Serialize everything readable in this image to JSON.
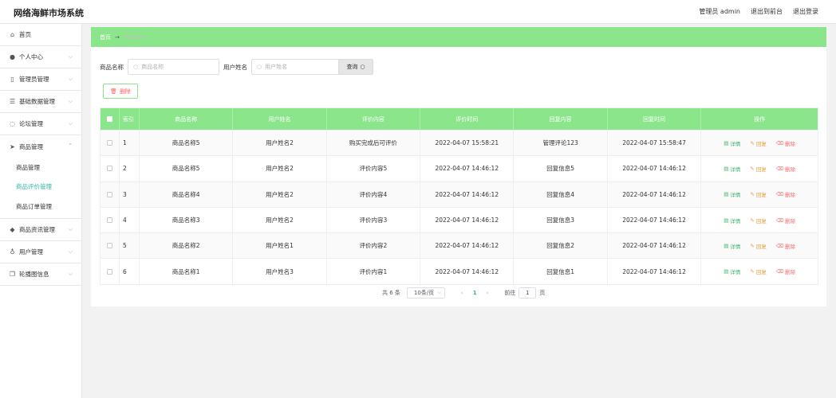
{
  "header": {
    "title": "网络海鲜市场系统",
    "admin_label": "管理员 admin",
    "to_front": "退出到前台",
    "logout": "退出登录"
  },
  "sidebar": {
    "items": [
      {
        "label": "首页",
        "icon": "home-icon"
      },
      {
        "label": "个人中心",
        "icon": "user-icon"
      },
      {
        "label": "管理员管理",
        "icon": "phone-icon"
      },
      {
        "label": "基础数据管理",
        "icon": "sliders-icon"
      },
      {
        "label": "论坛管理",
        "icon": "chat-icon"
      },
      {
        "label": "商品管理",
        "icon": "send-icon",
        "open": true,
        "children": [
          {
            "label": "商品管理"
          },
          {
            "label": "商品评价管理",
            "active": true
          },
          {
            "label": "商品订单管理"
          }
        ]
      },
      {
        "label": "商品资讯管理",
        "icon": "location-icon"
      },
      {
        "label": "用户管理",
        "icon": "mic-icon"
      },
      {
        "label": "轮播图信息",
        "icon": "copy-icon"
      }
    ]
  },
  "breadcrumb": {
    "home": "首页",
    "arrow": "→",
    "current": "商品评价"
  },
  "search": {
    "goods_label": "商品名称",
    "goods_placeholder": "商品名称",
    "user_label": "用户姓名",
    "user_placeholder": "用户姓名",
    "query_label": "查询"
  },
  "toolbar": {
    "delete_label": "删除"
  },
  "table": {
    "columns": [
      "索引",
      "商品名称",
      "用户姓名",
      "评价内容",
      "评价时间",
      "回复内容",
      "回复时间",
      "操作"
    ],
    "rows": [
      {
        "idx": "1",
        "goods": "商品名称5",
        "user": "用户姓名2",
        "content": "购买完成后可评价",
        "time": "2022-04-07 15:58:21",
        "reply": "管理评论123",
        "reply_time": "2022-04-07 15:58:47"
      },
      {
        "idx": "2",
        "goods": "商品名称5",
        "user": "用户姓名2",
        "content": "评价内容5",
        "time": "2022-04-07 14:46:12",
        "reply": "回复信息5",
        "reply_time": "2022-04-07 14:46:12"
      },
      {
        "idx": "3",
        "goods": "商品名称4",
        "user": "用户姓名2",
        "content": "评价内容4",
        "time": "2022-04-07 14:46:12",
        "reply": "回复信息4",
        "reply_time": "2022-04-07 14:46:12"
      },
      {
        "idx": "4",
        "goods": "商品名称3",
        "user": "用户姓名2",
        "content": "评价内容3",
        "time": "2022-04-07 14:46:12",
        "reply": "回复信息3",
        "reply_time": "2022-04-07 14:46:12"
      },
      {
        "idx": "5",
        "goods": "商品名称2",
        "user": "用户姓名1",
        "content": "评价内容2",
        "time": "2022-04-07 14:46:12",
        "reply": "回复信息2",
        "reply_time": "2022-04-07 14:46:12"
      },
      {
        "idx": "6",
        "goods": "商品名称1",
        "user": "用户姓名3",
        "content": "评价内容1",
        "time": "2022-04-07 14:46:12",
        "reply": "回复信息1",
        "reply_time": "2022-04-07 14:46:12"
      }
    ],
    "ops": {
      "detail": "详情",
      "edit": "回复",
      "delete": "删除"
    }
  },
  "pagination": {
    "total": "共 6 条",
    "page_size": "10条/页",
    "current_page": "1",
    "goto_label": "前往",
    "goto_value": "1",
    "page_unit": "页"
  },
  "colors": {
    "accent": "#8be58b",
    "active_menu": "#2fb9a4",
    "danger": "#f56c6c",
    "warning": "#e6a23c"
  }
}
